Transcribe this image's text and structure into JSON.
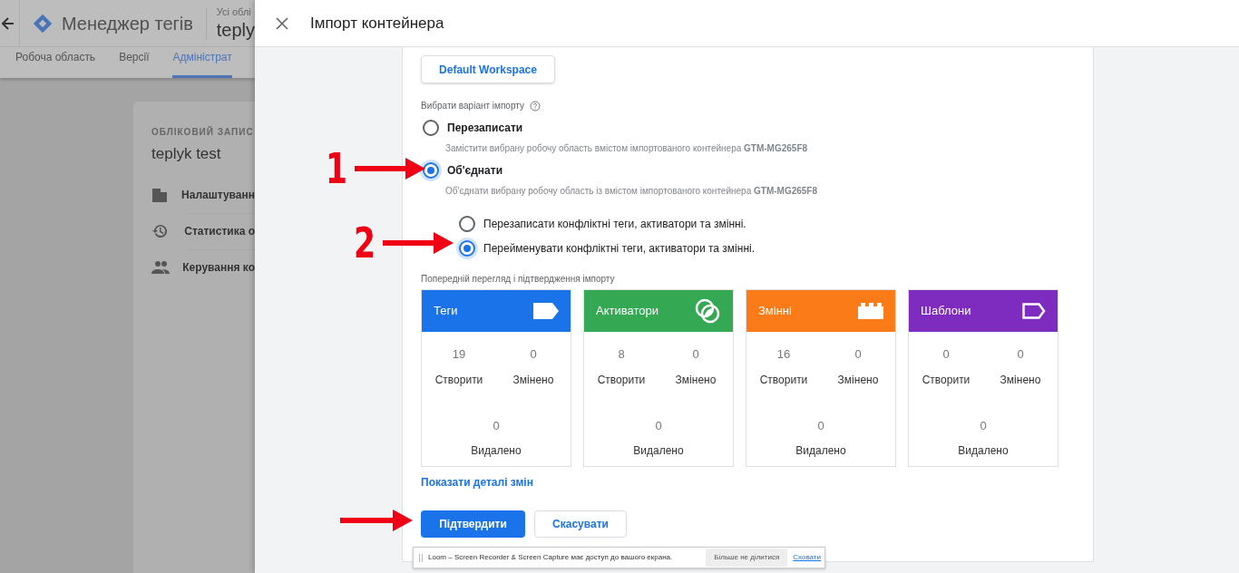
{
  "app": {
    "title": "Менеджер тегів",
    "account_label": "Усі облі",
    "container_name": "teply",
    "tabs": [
      {
        "label": "Робоча область",
        "selected": false
      },
      {
        "label": "Версії",
        "selected": false
      },
      {
        "label": "Адміністрат",
        "selected": true
      }
    ],
    "card": {
      "overline": "ОБЛІКОВИЙ ЗАПИС",
      "title": "teplyk test",
      "items": [
        {
          "kind": "building",
          "label": "Налаштуванн"
        },
        {
          "kind": "history",
          "label": "Статистика о"
        },
        {
          "kind": "people",
          "label": "Керування ко"
        }
      ]
    }
  },
  "dialog": {
    "title": "Імпорт контейнера",
    "workspace_button": "Default Workspace",
    "import_option_label": "Вибрати варіант імпорту",
    "options": [
      {
        "title": "Перезаписати",
        "description": "Замістити вибрану робочу область вмістом імпортованого контейнера **GTM-MG265F8**",
        "selected": false
      },
      {
        "title": "Об'єднати",
        "description": "Об'єднати вибрану робочу область із вмістом імпортованого контейнера **GTM-MG265F8**",
        "selected": true
      }
    ],
    "suboptions": [
      {
        "label": "Перезаписати конфліктні теги, активатори та змінні.",
        "selected": false
      },
      {
        "label": "Перейменувати конфліктні теги, активатори та змінні.",
        "selected": true
      }
    ],
    "preview_label": "Попередній перегляд і підтвердження імпорту",
    "tiles": [
      {
        "kind": "tag",
        "title": "Теги",
        "color": "#1a73e8",
        "created": "19",
        "created_label": "Створити",
        "changed": "0",
        "changed_label": "Змінено",
        "deleted": "0",
        "deleted_label": "Видалено"
      },
      {
        "kind": "trigger",
        "title": "Активатори",
        "color": "#34a853",
        "created": "8",
        "created_label": "Створити",
        "changed": "0",
        "changed_label": "Змінено",
        "deleted": "0",
        "deleted_label": "Видалено"
      },
      {
        "kind": "variable",
        "title": "Змінні",
        "color": "#fa7b17",
        "created": "16",
        "created_label": "Створити",
        "changed": "0",
        "changed_label": "Змінено",
        "deleted": "0",
        "deleted_label": "Видалено"
      },
      {
        "kind": "template",
        "title": "Шаблони",
        "color": "#7e2cbf",
        "created": "0",
        "created_label": "Створити",
        "changed": "0",
        "changed_label": "Змінено",
        "deleted": "0",
        "deleted_label": "Видалено"
      }
    ],
    "details_link": "Показати деталі змін",
    "confirm_button": "Підтвердити",
    "cancel_button": "Скасувати"
  },
  "notification": {
    "text": "Loom – Screen Recorder & Screen Capture має доступ до вашого екрана.",
    "stop_button": "Більше не ділитися",
    "hide_link": "Сховати"
  },
  "annotations": [
    {
      "kind": "numbered",
      "label": "1"
    },
    {
      "kind": "numbered",
      "label": "2"
    },
    {
      "kind": "plain"
    }
  ]
}
